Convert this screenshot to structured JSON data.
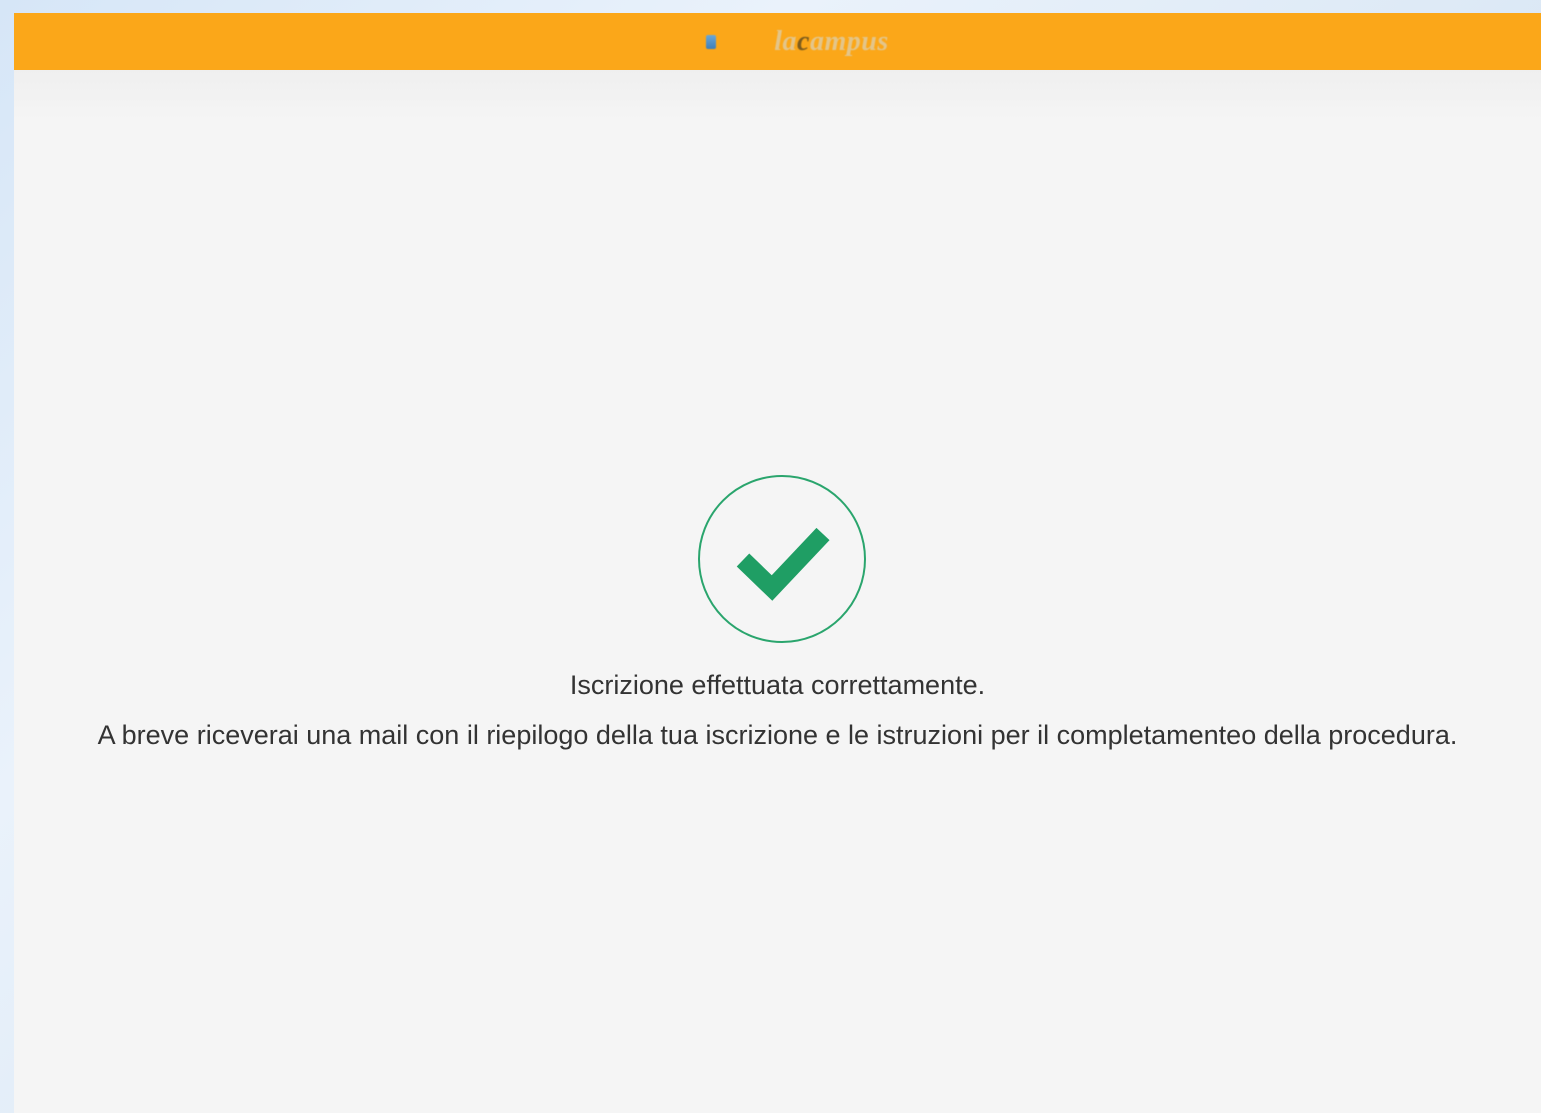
{
  "header": {
    "logo": {
      "text_part1": "la",
      "text_part2": "c",
      "text_part3": "ampus",
      "bar_color": "#fba719"
    }
  },
  "confirmation": {
    "icon": "check-circle-icon",
    "icon_color": "#2aa56d",
    "title": "Iscrizione effettuata correttamente.",
    "message": "A breve riceverai una mail con il riepilogo della tua iscrizione e le istruzioni per il completamenteo della procedura."
  }
}
